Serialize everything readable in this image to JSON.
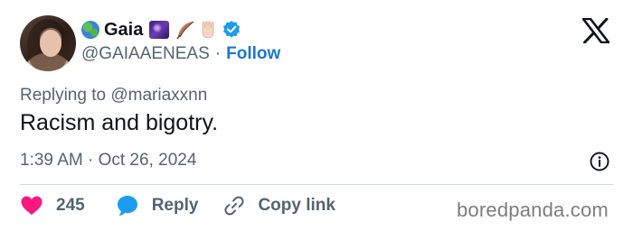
{
  "author": {
    "name": "Gaia",
    "handle": "@GAIAAENEAS",
    "separator": "·",
    "follow_label": "Follow",
    "name_emojis": [
      "globe-emoji",
      "milky-way-emoji",
      "feather-emoji",
      "vulcan-salute-emoji"
    ],
    "verified": true,
    "verified_color": "#1d9bf0"
  },
  "tweet": {
    "replying_to": "Replying to @mariaxxnn",
    "text": "Racism and bigotry.",
    "timestamp": "1:39 AM · Oct 26, 2024"
  },
  "actions": {
    "like_count": "245",
    "reply_label": "Reply",
    "copy_link_label": "Copy link"
  },
  "colors": {
    "like": "#f91880",
    "reply": "#1d9bf0",
    "follow": "#1d76d2",
    "secondary_text": "#536471"
  },
  "watermark": "boredpanda.com"
}
